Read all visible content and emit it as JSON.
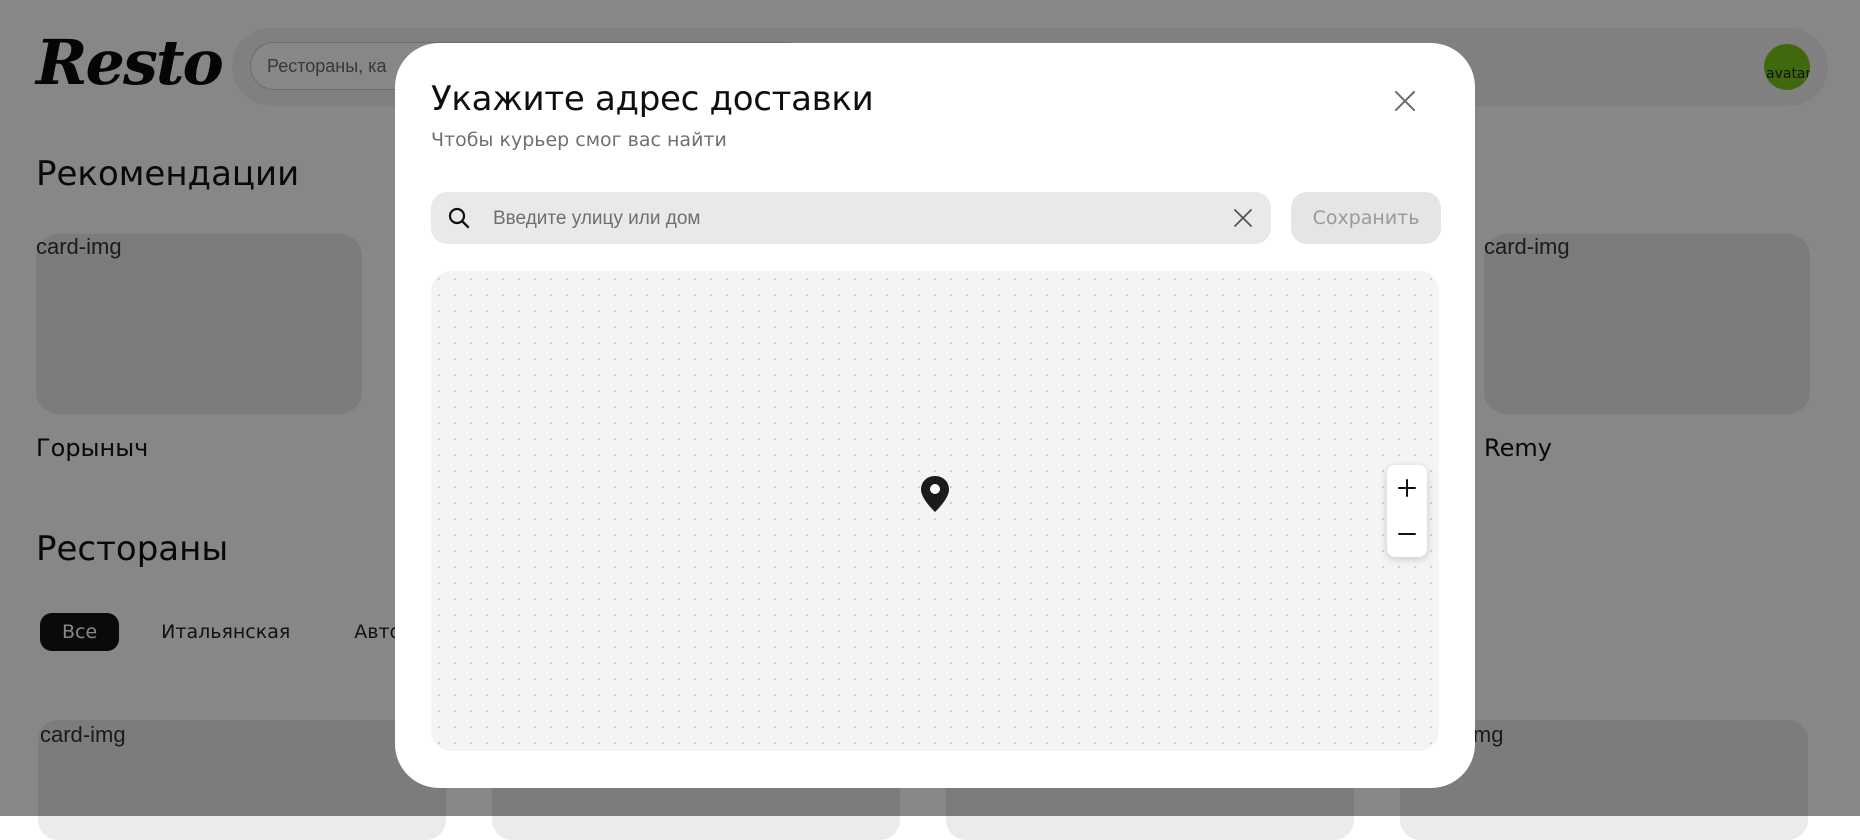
{
  "app": {
    "logo": "Resto"
  },
  "header": {
    "search_placeholder": "Рестораны, ка",
    "avatar_alt": "avatar"
  },
  "recommendations": {
    "title": "Рекомендации",
    "cards": [
      {
        "img_alt": "card-img",
        "name": "Горыныч"
      },
      {
        "img_alt": "card-img",
        "name": "Remy"
      }
    ]
  },
  "restaurants": {
    "title": "Рестораны",
    "categories": [
      {
        "label": "Все",
        "active": true
      },
      {
        "label": "Итальянская",
        "active": false
      },
      {
        "label": "Автор",
        "active": false
      }
    ],
    "cards": [
      {
        "img_alt": "card-img"
      },
      {
        "img_alt": "img"
      }
    ]
  },
  "modal": {
    "title": "Укажите адрес доставки",
    "subtitle": "Чтобы курьер смог вас найти",
    "address_placeholder": "Введите улицу или дом",
    "address_value": "",
    "save_label": "Сохранить",
    "zoom_in_label": "+",
    "zoom_out_label": "−",
    "icons": {
      "close": "close-icon",
      "search": "search-icon",
      "clear": "clear-icon",
      "pin": "map-pin-icon"
    }
  },
  "colors": {
    "overlay": "#000000",
    "active_chip": "#141414",
    "avatar": "#79c71a",
    "save_button_disabled_bg": "#e5e5e5"
  }
}
